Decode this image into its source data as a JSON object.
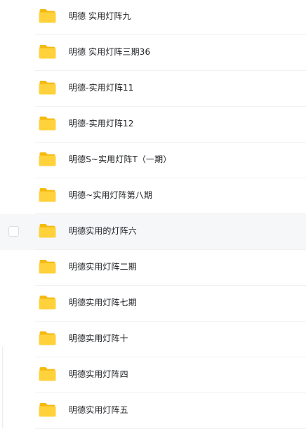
{
  "files": [
    {
      "name": "明德 实用灯阵九"
    },
    {
      "name": "明德 实用灯阵三期36"
    },
    {
      "name": "明德-实用灯阵11"
    },
    {
      "name": "明德-实用灯阵12"
    },
    {
      "name": "明德S~实用灯阵T（一期）"
    },
    {
      "name": "明德~实用灯阵第八期"
    },
    {
      "name": "明德实用的灯阵六"
    },
    {
      "name": "明德实用灯阵二期"
    },
    {
      "name": "明德实用灯阵七期"
    },
    {
      "name": "明德实用灯阵十"
    },
    {
      "name": "明德实用灯阵四"
    },
    {
      "name": "明德实用灯阵五"
    }
  ],
  "hovered_index": 6,
  "colors": {
    "folder_back": "#f5b90f",
    "folder_front": "#ffd23c",
    "hover_bg": "#f6f7f9",
    "text": "#202226"
  },
  "icons": {
    "item": "folder-icon",
    "select": "checkbox"
  }
}
